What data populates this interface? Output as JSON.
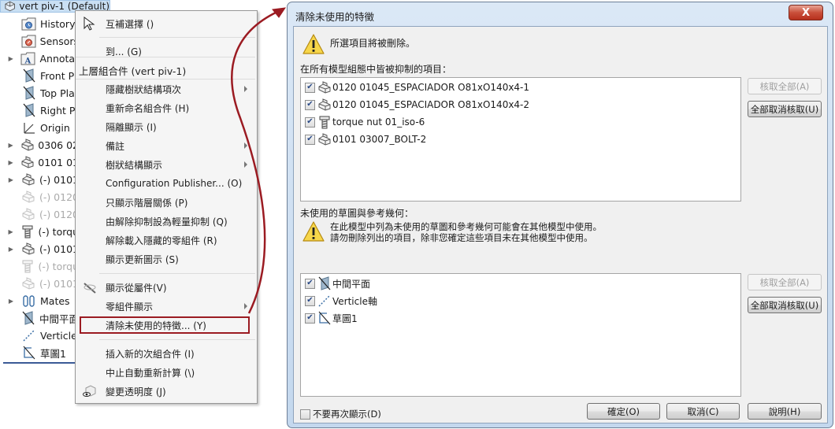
{
  "tree": {
    "root": "vert piv-1  (Default)",
    "items": [
      {
        "label": "History",
        "icon": "history-folder-icon",
        "expandable": false,
        "dim": false
      },
      {
        "label": "Sensors",
        "icon": "sensors-folder-icon",
        "expandable": false,
        "dim": false
      },
      {
        "label": "Annotat",
        "icon": "annotations-folder-icon",
        "expandable": true,
        "dim": false
      },
      {
        "label": "Front Pl",
        "icon": "plane-icon",
        "expandable": false,
        "dim": false
      },
      {
        "label": "Top Pla",
        "icon": "plane-icon",
        "expandable": false,
        "dim": false
      },
      {
        "label": "Right Pl",
        "icon": "plane-icon",
        "expandable": false,
        "dim": false
      },
      {
        "label": "Origin",
        "icon": "origin-icon",
        "expandable": false,
        "dim": false
      },
      {
        "label": "0306 02",
        "icon": "part-icon",
        "expandable": true,
        "dim": false
      },
      {
        "label": "0101 01",
        "icon": "part-icon",
        "expandable": true,
        "dim": false
      },
      {
        "label": "(-) 0101",
        "icon": "part-icon",
        "expandable": true,
        "dim": false
      },
      {
        "label": "(-) 0120",
        "icon": "part-icon",
        "expandable": false,
        "dim": true
      },
      {
        "label": "(-) 0120",
        "icon": "part-icon",
        "expandable": false,
        "dim": true
      },
      {
        "label": "(-) torqu",
        "icon": "bolt-icon",
        "expandable": true,
        "dim": false
      },
      {
        "label": "(-) 0101",
        "icon": "part-icon",
        "expandable": true,
        "dim": false
      },
      {
        "label": "(-) torqu",
        "icon": "bolt-icon",
        "expandable": false,
        "dim": true
      },
      {
        "label": "(-) 0101",
        "icon": "part-icon",
        "expandable": false,
        "dim": true
      },
      {
        "label": "Mates",
        "icon": "mates-icon",
        "expandable": true,
        "dim": false
      },
      {
        "label": "中間平面",
        "icon": "plane-icon",
        "expandable": false,
        "dim": false
      },
      {
        "label": "Verticle",
        "icon": "axis-icon",
        "expandable": false,
        "dim": false
      },
      {
        "label": "草圖1",
        "icon": "sketch-icon",
        "expandable": false,
        "dim": false
      }
    ]
  },
  "menu": {
    "items": [
      {
        "label": "互補選擇 ()",
        "icon": "cursor-select-icon"
      },
      {
        "label": "到... (G)"
      },
      {
        "label": "上層組合件 (vert piv-1)",
        "header": true
      },
      {
        "label": "隱藏樹狀結構項次",
        "submenu": true
      },
      {
        "label": "重新命名組合件 (H)"
      },
      {
        "label": "隔離顯示 (I)"
      },
      {
        "label": "備註",
        "submenu": true
      },
      {
        "label": "樹狀結構顯示",
        "submenu": true
      },
      {
        "label": "Configuration Publisher... (O)"
      },
      {
        "label": "只顯示階層關係 (P)"
      },
      {
        "label": "由解除抑制設為輕量抑制 (Q)"
      },
      {
        "label": "解除載入隱藏的零組件 (R)"
      },
      {
        "label": "顯示更新圖示 (S)"
      },
      {
        "label": "顯示從屬件(V)",
        "icon": "hide-show-icon"
      },
      {
        "label": "零組件顯示",
        "submenu": true
      },
      {
        "label": "清除未使用的特徵... (Y)",
        "highlighted": true
      },
      {
        "label": "插入新的次組合件 (I)"
      },
      {
        "label": "中止自動重新計算 (\\)"
      },
      {
        "label": "變更透明度 (J)",
        "icon": "transparency-icon"
      }
    ]
  },
  "dialog": {
    "title": "清除未使用的特徵",
    "close_label": "X",
    "warning_top": "所選項目將被刪除。",
    "section1_label": "在所有模型組態中皆被抑制的項目：",
    "section1_items": [
      {
        "label": "0120 01045_ESPACIADOR O81xO140x4-1",
        "icon": "part-icon",
        "checked": true
      },
      {
        "label": "0120 01045_ESPACIADOR O81xO140x4-2",
        "icon": "part-icon",
        "checked": true
      },
      {
        "label": "torque nut 01_iso-6",
        "icon": "bolt-icon",
        "checked": true
      },
      {
        "label": "0101 03007_BOLT-2",
        "icon": "part-icon",
        "checked": true
      }
    ],
    "section1_buttons": {
      "check_all": "核取全部(A)",
      "uncheck_all": "全部取消核取(U)"
    },
    "section2_label": "未使用的草圖與參考幾何：",
    "warning_line1": "在此模型中列為未使用的草圖和參考幾何可能會在其他模型中使用。",
    "warning_line2": "請勿刪除列出的項目，除非您確定這些項目未在其他模型中使用。",
    "section2_items": [
      {
        "label": "中間平面",
        "icon": "plane-icon",
        "checked": true
      },
      {
        "label": "Verticle軸",
        "icon": "axis-icon",
        "checked": true
      },
      {
        "label": "草圖1",
        "icon": "sketch-icon",
        "checked": true
      }
    ],
    "section2_buttons": {
      "check_all": "核取全部(A)",
      "uncheck_all": "全部取消核取(U)"
    },
    "dont_show_again": "不要再次顯示(D)",
    "dont_show_again_checked": false,
    "ok_label": "確定(O)",
    "cancel_label": "取消(C)",
    "help_label": "說明(H)"
  },
  "colors": {
    "highlight_box": "#9b1b22",
    "arrow": "#9b1b22",
    "tree_selection": "#c9dff3"
  }
}
